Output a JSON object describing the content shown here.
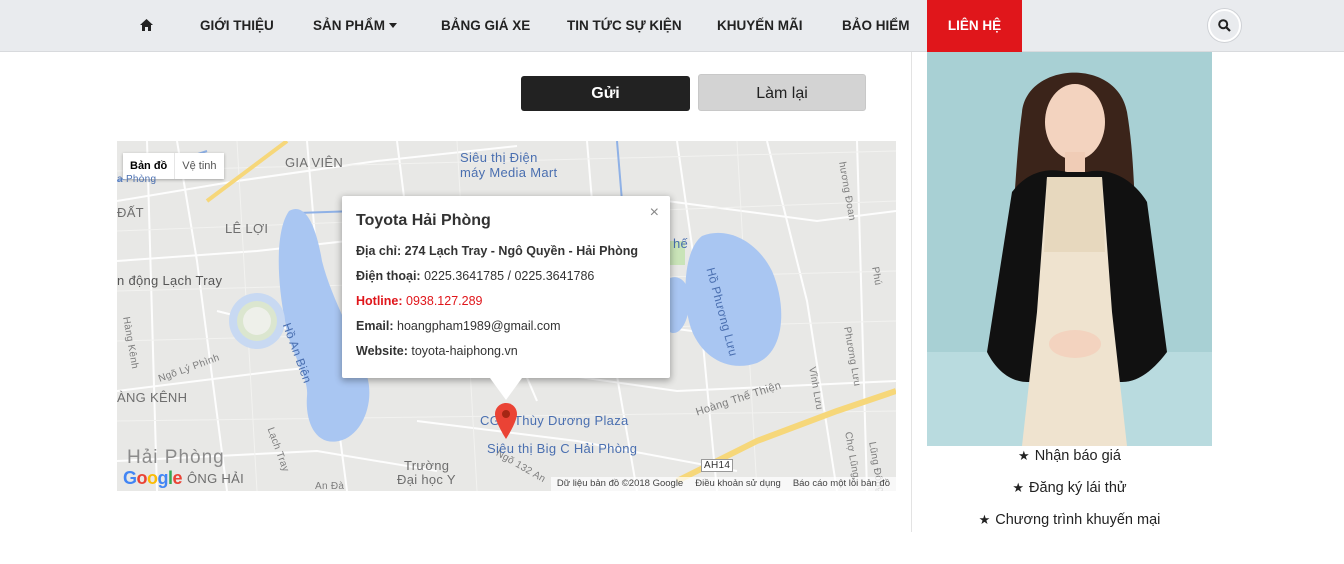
{
  "nav": {
    "home_icon": "home-icon",
    "items": [
      {
        "label": "GIỚI THIỆU"
      },
      {
        "label": "SẢN PHẨM"
      },
      {
        "label": "BẢNG GIÁ XE"
      },
      {
        "label": "TIN TỨC SỰ KIỆN"
      },
      {
        "label": "KHUYẾN MÃI"
      },
      {
        "label": "BẢO HIỂM"
      },
      {
        "label": "LIÊN HỆ"
      }
    ],
    "active_color": "#e0161b",
    "search_icon": "search-icon"
  },
  "form": {
    "send_label": "Gửi",
    "reset_label": "Làm lại"
  },
  "map": {
    "type_map": "Bản đồ",
    "type_satellite": "Vệ tinh",
    "labels": {
      "gia_vien": "GIA VIÊN",
      "media_mart_1": "Siêu thị Điện",
      "media_mart_2": "máy Media Mart",
      "le_loi": "LÊ LỢI",
      "lach_tray_stadium": "n động Lạch Tray",
      "ho_an_bien": "Hồ An Biên",
      "ho_phuong_luu": "Hồ Phương Lưu",
      "hang_kenh_road": "Hàng Kênh",
      "hang_kenh_area": "ÀNG KÊNH",
      "hai_phong": "Hải Phòng",
      "ong_hai": "ÔNG HẢI",
      "lach_tray_road": "Lạch Tray",
      "thuy_duong": "Thùy Dương Plaza",
      "big_c": "Siêu thị Big C Hải Phòng",
      "truong_1": "Trường",
      "truong_2": "Đại học Y",
      "hoang_the_thien": "Hoàng Thế Thiện",
      "ngo_ly_phinh": "Ngõ Lý Phình",
      "vinh_luu": "Vĩnh Lưu",
      "phuong_luu": "Phương Lưu",
      "cho_lung": "Chợ Lũng",
      "lung_dong": "Lũng Đông",
      "ah14": "AH14",
      "an_da": "An Đà",
      "dat": "ĐẤT",
      "lach_tray_small": "a Phòng",
      "ngo_132": "Ngõ 132 An",
      "phuong_doan": "hương Đoan",
      "phu": "Phú",
      "cgv": "CG",
      "he": "hế"
    },
    "attribution": [
      "Dữ liệu bản đồ ©2018 Google",
      "Điều khoản sử dụng",
      "Báo cáo một lỗi bản đồ"
    ],
    "google": "Google",
    "info": {
      "title": "Toyota Hải Phòng",
      "address": "Địa chỉ: 274 Lạch Tray - Ngô Quyền - Hải Phòng",
      "phone_label": "Điện thoại:",
      "phone_value": "0225.3641785 / 0225.3641786",
      "hotline_label": "Hotline:",
      "hotline_value": "0938.127.289",
      "email_label": "Email:",
      "email_value": "hoangpham1989@gmail.com",
      "website_label": "Website:",
      "website_value": "toyota-haiphong.vn",
      "close": "×"
    }
  },
  "sidebar": {
    "links": [
      {
        "label": "Nhận báo giá"
      },
      {
        "label": "Đăng ký lái thử"
      },
      {
        "label": "Chương trình khuyến mại"
      }
    ]
  }
}
